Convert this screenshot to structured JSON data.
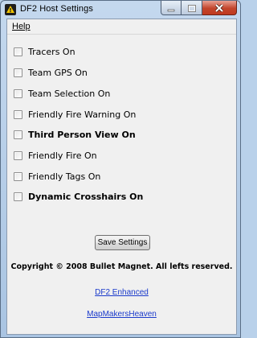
{
  "window": {
    "title": "DF2 Host Settings",
    "app_icon": "df2-app-icon",
    "caption_buttons": [
      "minimize-icon",
      "maximize-icon",
      "close-icon"
    ]
  },
  "menu": {
    "help": "Help"
  },
  "options": [
    {
      "label": "Tracers On",
      "checked": false,
      "bold": false
    },
    {
      "label": "Team GPS On",
      "checked": false,
      "bold": false
    },
    {
      "label": "Team Selection On",
      "checked": false,
      "bold": false
    },
    {
      "label": "Friendly Fire Warning On",
      "checked": false,
      "bold": false
    },
    {
      "label": "Third Person View On",
      "checked": false,
      "bold": true
    },
    {
      "label": "Friendly Fire On",
      "checked": false,
      "bold": false
    },
    {
      "label": "Friendly Tags On",
      "checked": false,
      "bold": false
    },
    {
      "label": "Dynamic Crosshairs On",
      "checked": false,
      "bold": true
    }
  ],
  "save_button": "Save Settings",
  "copyright": "Copyright © 2008 Bullet Magnet. All lefts reserved.",
  "links": [
    "DF2 Enhanced",
    "MapMakersHeaven"
  ],
  "colors": {
    "link": "#1a3acb",
    "close_button": "#c0391f"
  }
}
